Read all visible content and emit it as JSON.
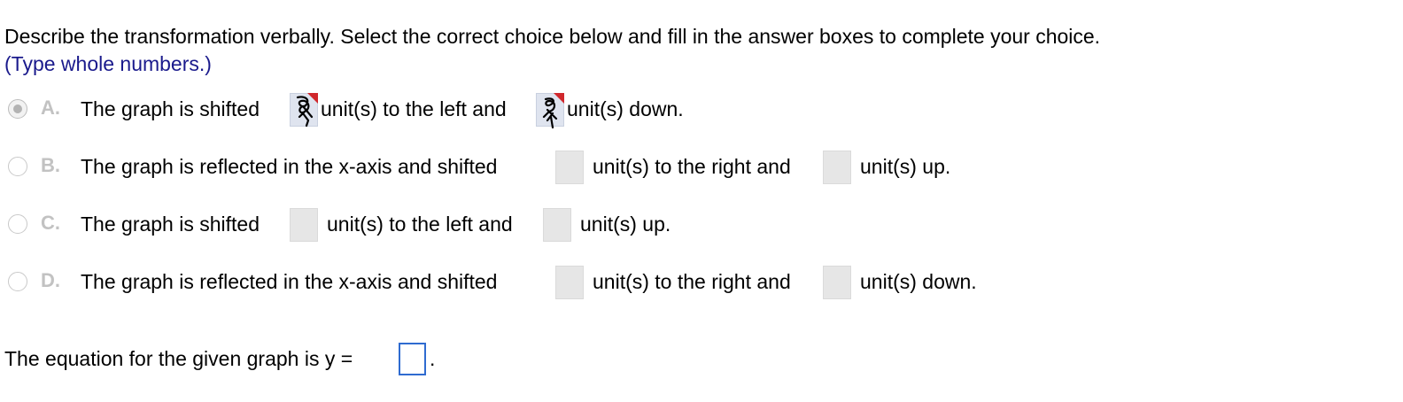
{
  "question": {
    "instruction": "Describe the transformation verbally. Select the correct choice below and fill in the answer boxes to complete your choice.",
    "hint": "(Type whole numbers.)"
  },
  "choices": [
    {
      "letter": "A.",
      "selected": true,
      "parts": [
        "The graph is shifted",
        "unit(s) to the left and",
        "unit(s) down."
      ]
    },
    {
      "letter": "B.",
      "selected": false,
      "parts": [
        "The graph is reflected in the x-axis and shifted",
        "unit(s) to the right and",
        "unit(s) up."
      ]
    },
    {
      "letter": "C.",
      "selected": false,
      "parts": [
        "The graph is shifted",
        "unit(s) to the left and",
        "unit(s) up."
      ]
    },
    {
      "letter": "D.",
      "selected": false,
      "parts": [
        "The graph is reflected in the x-axis and shifted",
        "unit(s) to the right and",
        "unit(s) down."
      ]
    }
  ],
  "equation": {
    "label": "The equation for the given graph is y =",
    "suffix": "."
  },
  "colors": {
    "hint_text": "#1a1a8c",
    "answer_box_border": "#2f6bd0",
    "incorrect_flag": "#d0272c"
  }
}
